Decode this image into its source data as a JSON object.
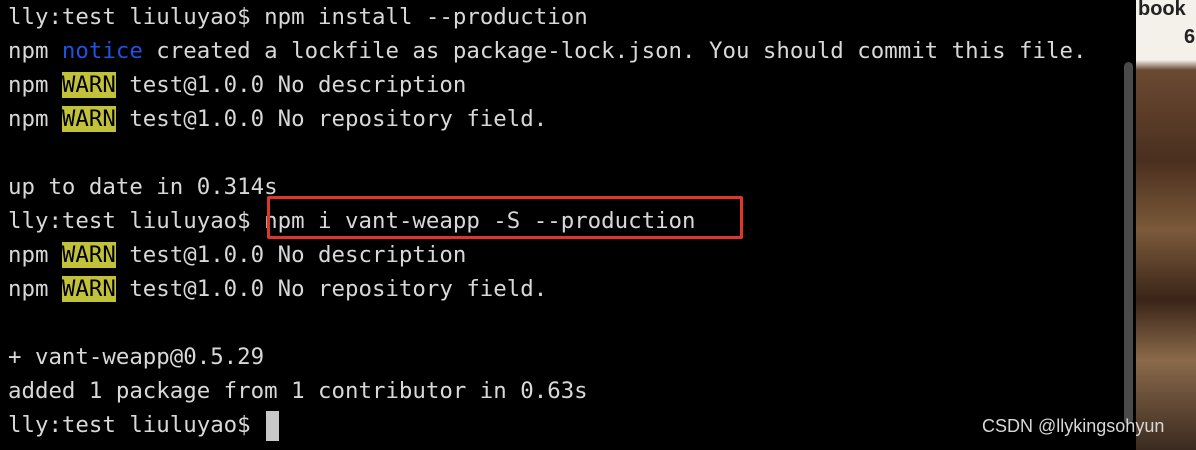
{
  "terminal": {
    "background": "#000000",
    "lines": [
      {
        "prompt": "lly:test liuluyao$ ",
        "command": "npm install --production"
      },
      {
        "prefix": "npm ",
        "tag": "notice",
        "message": " created a lockfile as package-lock.json. You should commit this file."
      },
      {
        "prefix": "npm ",
        "tag": "WARN",
        "message": " test@1.0.0 No description"
      },
      {
        "prefix": "npm ",
        "tag": "WARN",
        "message": " test@1.0.0 No repository field."
      },
      {
        "text": ""
      },
      {
        "text": "up to date in 0.314s"
      },
      {
        "prompt": "lly:test liuluyao$ ",
        "command": "npm i vant-weapp -S --production"
      },
      {
        "prefix": "npm ",
        "tag": "WARN",
        "message": " test@1.0.0 No description"
      },
      {
        "prefix": "npm ",
        "tag": "WARN",
        "message": " test@1.0.0 No repository field."
      },
      {
        "text": ""
      },
      {
        "text": "+ vant-weapp@0.5.29"
      },
      {
        "text": "added 1 package from 1 contributor in 0.63s"
      },
      {
        "prompt": "lly:test liuluyao$ ",
        "command": ""
      }
    ]
  },
  "colors": {
    "notice": "#1e52e0",
    "warn_bg": "#c2c13a",
    "highlight_border": "#e0352b",
    "text": "#d8d8d8"
  },
  "side_panel": {
    "text_top": "book",
    "text_second": "6"
  },
  "watermark": "CSDN @llykingsohyun"
}
